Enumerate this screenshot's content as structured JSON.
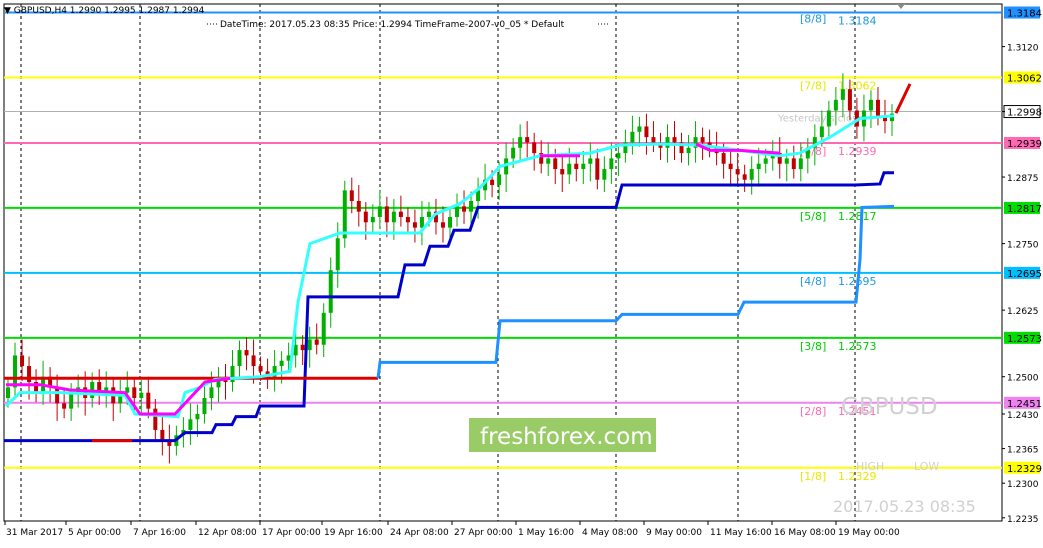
{
  "header": {
    "symbol_line": "GBPUSD,H4  1.2990 1.2995 1.2987 1.2994",
    "info_line": "DateTime: 2017.05.23 08:35     Price: 1.2994     TimeFrame-2007-v0_05     *  Default"
  },
  "watermark": {
    "brand": "freshforex.com",
    "symbol": "GBPUSD",
    "datetime": "2017.05.23 08:35",
    "high_label": "HIGH",
    "low_label": "LOW",
    "yesterday_label": "Yesterday's close"
  },
  "colors": {
    "bull": "#00b000",
    "bear": "#c00000",
    "cyan_line": "#33ffff",
    "magenta_line": "#ff00ff",
    "blue_line": "#0000cc",
    "light_blue_line": "#1e90ff",
    "red_segment": "#dd0000",
    "brand_bg": "#99cc66"
  },
  "chart_data": {
    "type": "candlestick",
    "symbol": "GBPUSD",
    "timeframe": "H4",
    "ylim": [
      1.2229,
      1.32
    ],
    "y_ticks": [
      "1.3120",
      "1.2998",
      "1.2875",
      "1.2750",
      "1.2625",
      "1.2500",
      "1.2430",
      "1.2365",
      "1.2300",
      "1.2235"
    ],
    "x_ticks": [
      "31 Mar 2017",
      "5 Apr 00:00",
      "7 Apr 16:00",
      "12 Apr 08:00",
      "17 Apr 00:00",
      "19 Apr 16:00",
      "24 Apr 08:00",
      "27 Apr 00:00",
      "1 May 16:00",
      "4 May 08:00",
      "9 May 00:00",
      "11 May 16:00",
      "16 May 08:00",
      "19 May 00:00"
    ],
    "current_price": "1.2994",
    "current_price_label": "1.2998",
    "murrey_levels": [
      {
        "label": "[8/8]",
        "value": "1.3184",
        "price": 1.3184,
        "color": "#1e90ff",
        "text_color": "#1e9bd7"
      },
      {
        "label": "[7/8]",
        "value": "1.3062",
        "price": 1.3062,
        "color": "#ffff00",
        "text_color": "#e8e800"
      },
      {
        "label": "[6/8]",
        "value": "1.2939",
        "price": 1.2939,
        "color": "#ff69b4",
        "text_color": "#ff69b4"
      },
      {
        "label": "[5/8]",
        "value": "1.2817",
        "price": 1.2817,
        "color": "#00dd00",
        "text_color": "#00cc00"
      },
      {
        "label": "[4/8]",
        "value": "1.2695",
        "price": 1.2695,
        "color": "#00bfff",
        "text_color": "#1e9bd7"
      },
      {
        "label": "[3/8]",
        "value": "1.2573",
        "price": 1.2573,
        "color": "#00dd00",
        "text_color": "#00cc00"
      },
      {
        "label": "[2/8]",
        "value": "1.2451",
        "price": 1.2451,
        "color": "#ee82ee",
        "text_color": "#ff69b4"
      },
      {
        "label": "[1/8]",
        "value": "1.2329",
        "price": 1.2329,
        "color": "#ffff00",
        "text_color": "#e8e800"
      }
    ],
    "candle_closes": [
      1.248,
      1.254,
      1.252,
      1.249,
      1.247,
      1.25,
      1.248,
      1.245,
      1.244,
      1.247,
      1.248,
      1.246,
      1.249,
      1.247,
      1.248,
      1.245,
      1.247,
      1.248,
      1.246,
      1.247,
      1.244,
      1.24,
      1.238,
      1.237,
      1.239,
      1.24,
      1.242,
      1.243,
      1.246,
      1.248,
      1.25,
      1.249,
      1.252,
      1.255,
      1.254,
      1.252,
      1.251,
      1.25,
      1.252,
      1.253,
      1.254,
      1.256,
      1.255,
      1.257,
      1.256,
      1.262,
      1.27,
      1.276,
      1.285,
      1.283,
      1.281,
      1.279,
      1.28,
      1.282,
      1.279,
      1.281,
      1.28,
      1.279,
      1.278,
      1.28,
      1.281,
      1.279,
      1.278,
      1.28,
      1.282,
      1.281,
      1.283,
      1.285,
      1.287,
      1.286,
      1.288,
      1.291,
      1.293,
      1.295,
      1.294,
      1.292,
      1.29,
      1.291,
      1.289,
      1.288,
      1.29,
      1.289,
      1.29,
      1.291,
      1.287,
      1.289,
      1.291,
      1.292,
      1.294,
      1.296,
      1.297,
      1.295,
      1.294,
      1.293,
      1.295,
      1.294,
      1.292,
      1.293,
      1.295,
      1.294,
      1.293,
      1.292,
      1.29,
      1.289,
      1.288,
      1.287,
      1.289,
      1.29,
      1.291,
      1.292,
      1.29,
      1.291,
      1.289,
      1.291,
      1.293,
      1.295,
      1.297,
      1.3,
      1.302,
      1.304,
      1.3,
      1.297,
      1.3,
      1.302,
      1.299,
      1.298,
      1.2994
    ]
  }
}
